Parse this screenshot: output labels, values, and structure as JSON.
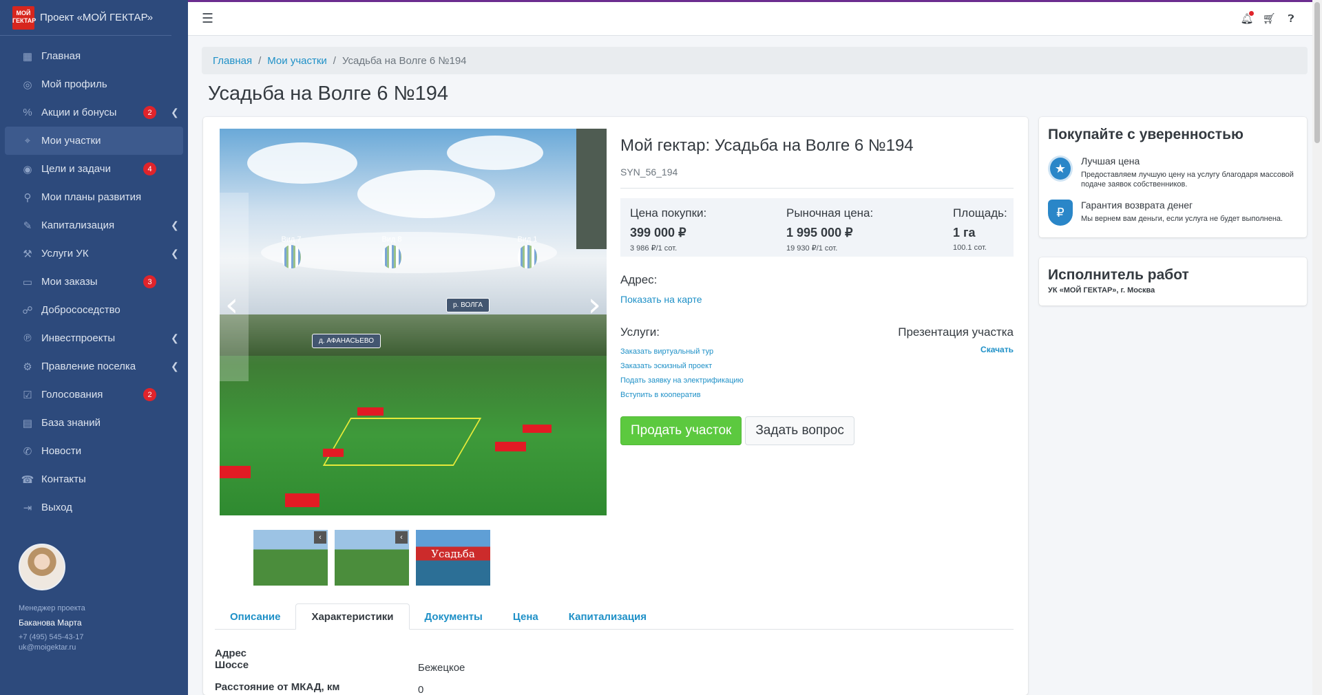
{
  "app": {
    "brand_logo": "МОЙ ГЕКТАР",
    "brand_title": "Проект «МОЙ ГЕКТАР»"
  },
  "colors": {
    "sidebar": "#2d4a7c",
    "accent_link": "#1e90c7",
    "badge": "#e0242b",
    "button_sell": "#5cc93f"
  },
  "sidebar": {
    "items": [
      {
        "label": "Главная",
        "icon": "grid-icon",
        "badge": "",
        "chevron": false,
        "active": false
      },
      {
        "label": "Мой профиль",
        "icon": "profile-icon",
        "badge": "",
        "chevron": false,
        "active": false
      },
      {
        "label": "Акции и бонусы",
        "icon": "percent-icon",
        "badge": "2",
        "chevron": true,
        "active": false
      },
      {
        "label": "Мои участки",
        "icon": "map-pin-icon",
        "badge": "",
        "chevron": false,
        "active": true
      },
      {
        "label": "Цели и задачи",
        "icon": "target-icon",
        "badge": "4",
        "chevron": false,
        "active": false
      },
      {
        "label": "Мои планы развития",
        "icon": "plans-icon",
        "badge": "",
        "chevron": false,
        "active": false
      },
      {
        "label": "Капитализация",
        "icon": "edit-icon",
        "badge": "",
        "chevron": true,
        "active": false
      },
      {
        "label": "Услуги УК",
        "icon": "services-icon",
        "badge": "",
        "chevron": true,
        "active": false
      },
      {
        "label": "Мои заказы",
        "icon": "orders-icon",
        "badge": "3",
        "chevron": false,
        "active": false
      },
      {
        "label": "Добрососедство",
        "icon": "handshake-icon",
        "badge": "",
        "chevron": false,
        "active": false
      },
      {
        "label": "Инвестпроекты",
        "icon": "invest-icon",
        "badge": "",
        "chevron": true,
        "active": false
      },
      {
        "label": "Правление поселка",
        "icon": "board-icon",
        "badge": "",
        "chevron": true,
        "active": false
      },
      {
        "label": "Голосования",
        "icon": "vote-icon",
        "badge": "2",
        "chevron": false,
        "active": false
      },
      {
        "label": "База знаний",
        "icon": "book-icon",
        "badge": "",
        "chevron": false,
        "active": false
      },
      {
        "label": "Новости",
        "icon": "news-icon",
        "badge": "",
        "chevron": false,
        "active": false
      },
      {
        "label": "Контакты",
        "icon": "contacts-icon",
        "badge": "",
        "chevron": false,
        "active": false
      },
      {
        "label": "Выход",
        "icon": "logout-icon",
        "badge": "",
        "chevron": false,
        "active": false
      }
    ],
    "manager": {
      "role": "Менеджер проекта",
      "name": "Баканова Марта",
      "phone": "+7 (495) 545-43-17",
      "email": "uk@moigektar.ru"
    }
  },
  "header": {
    "menu_icon": "hamburger-icon",
    "icons": [
      "bell-icon",
      "cart-icon",
      "help-icon"
    ]
  },
  "breadcrumb": {
    "items": [
      "Главная",
      "Мои участки"
    ],
    "current": "Усадьба на Волге 6 №194"
  },
  "page": {
    "title": "Усадьба на Волге 6 №194"
  },
  "gallery": {
    "labels": {
      "balloon_1": "Вид 7",
      "balloon_2": "Вид 8",
      "balloon_3": "Вид 1",
      "river": "р. ВОЛГА",
      "village": "д. АФАНАСЬЕВО"
    },
    "thumbnails": [
      "",
      "",
      "Усадьба"
    ]
  },
  "product": {
    "title": "Мой гектар: Усадьба на Волге 6 №194",
    "code": "SYN_56_194",
    "price_label": "Цена покупки:",
    "price_value": "399 000 ₽",
    "price_sub": "3 986 ₽/1 сот.",
    "market_label": "Рыночная цена:",
    "market_value": "1 995 000 ₽",
    "market_sub": "19 930 ₽/1 сот.",
    "area_label": "Площадь:",
    "area_value": "1 га",
    "area_sub": "100.1 сот.",
    "address_label": "Адрес:",
    "show_map": "Показать на карте",
    "services_label": "Услуги:",
    "services": [
      "Заказать виртуальный тур",
      "Заказать эскизный проект",
      "Подать заявку на электрификацию",
      "Вступить в кооператив"
    ],
    "presentation_label": "Презентация участка",
    "download": "Скачать",
    "sell_button": "Продать участок",
    "ask_button": "Задать вопрос"
  },
  "tabs": {
    "items": [
      "Описание",
      "Характеристики",
      "Документы",
      "Цена",
      "Капитализация"
    ],
    "active": "Характеристики"
  },
  "properties": {
    "heading": "Адрес",
    "rows": [
      {
        "key": "Шоссе",
        "value": "Бежецкое"
      },
      {
        "key": "Расстояние от МКАД, км",
        "value": "0"
      }
    ]
  },
  "confidence": {
    "title": "Покупайте с уверенностью",
    "benefits": [
      {
        "icon": "star-icon",
        "title": "Лучшая цена",
        "desc": "Предоставляем лучшую цену на услугу благодаря массовой подаче заявок собственников."
      },
      {
        "icon": "ruble-shield-icon",
        "title": "Гарантия возврата денег",
        "desc": "Мы вернем вам деньги, если услуга не будет выполнена."
      }
    ]
  },
  "executor": {
    "title": "Исполнитель работ",
    "subtitle": "УК «МОЙ ГЕКТАР», г. Москва"
  }
}
